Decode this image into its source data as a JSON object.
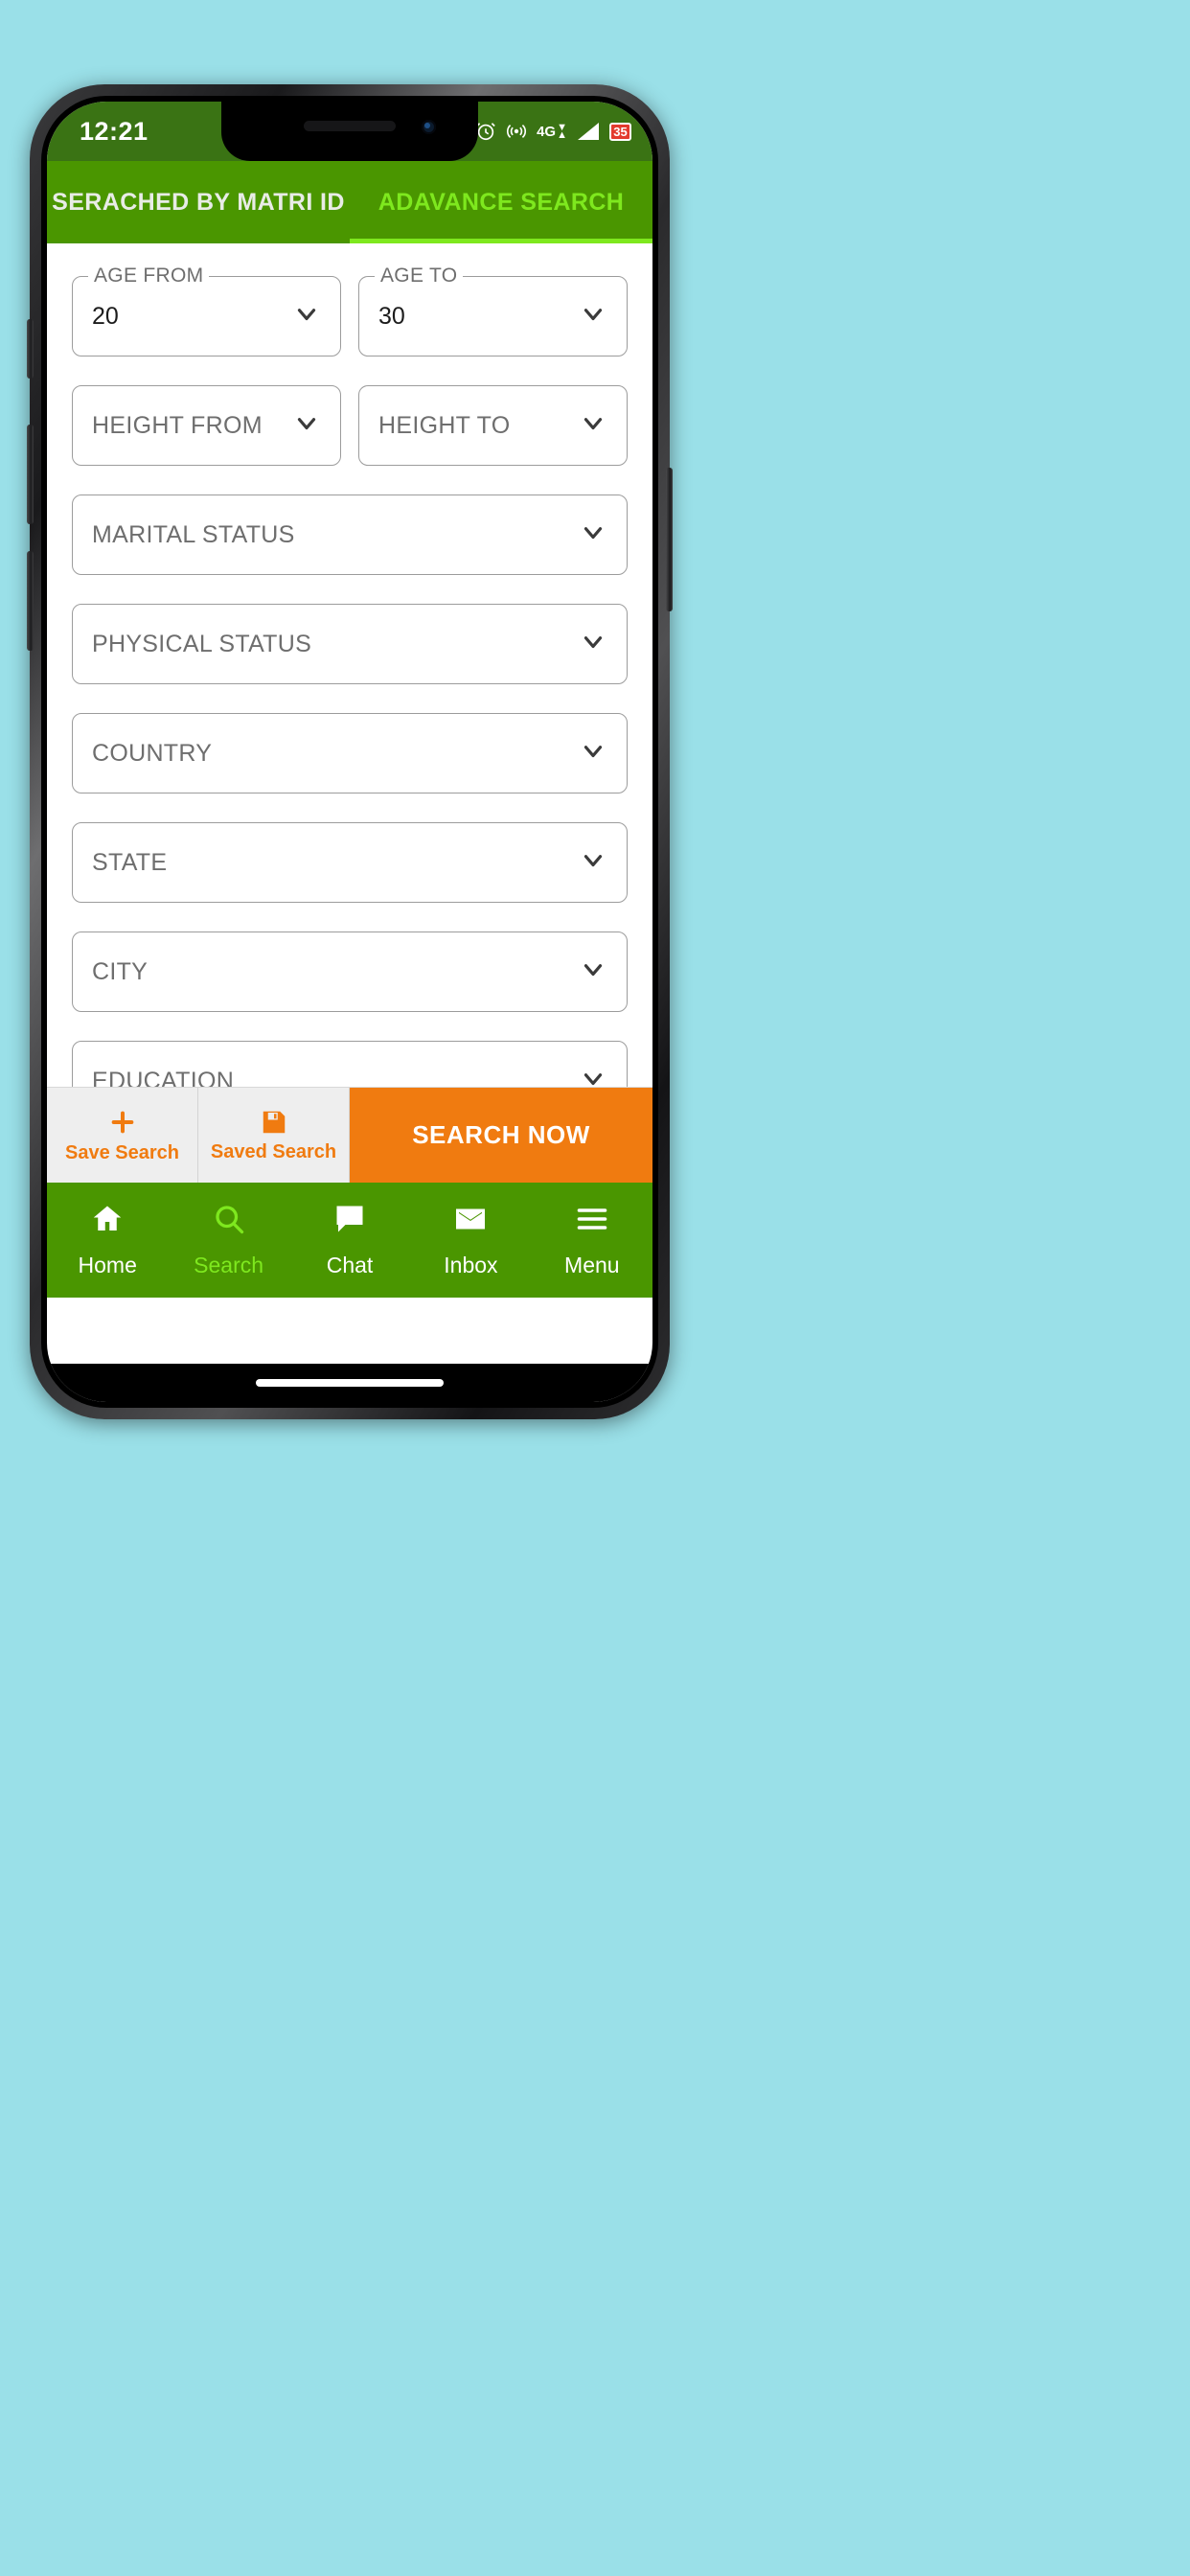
{
  "status_bar": {
    "time": "12:21",
    "icons": [
      {
        "name": "alarm-icon"
      },
      {
        "name": "wifi-hotspot-icon"
      },
      {
        "name": "network-4g-icon",
        "label": "4G"
      },
      {
        "name": "signal-bars-icon"
      }
    ],
    "battery_level": "35"
  },
  "tabs": [
    {
      "label": "SERACHED BY MATRI ID",
      "active": false,
      "name": "tab-searched-by-matri-id"
    },
    {
      "label": "ADAVANCE SEARCH",
      "active": true,
      "name": "tab-advance-search"
    }
  ],
  "form": {
    "rows": [
      {
        "fields": [
          {
            "name": "age-from-select",
            "float_label": "AGE FROM",
            "value": "20",
            "placeholder": ""
          },
          {
            "name": "age-to-select",
            "float_label": "AGE TO",
            "value": "30",
            "placeholder": ""
          }
        ]
      },
      {
        "fields": [
          {
            "name": "height-from-select",
            "float_label": "",
            "value": "",
            "placeholder": "HEIGHT FROM"
          },
          {
            "name": "height-to-select",
            "float_label": "",
            "value": "",
            "placeholder": "HEIGHT TO"
          }
        ]
      },
      {
        "fields": [
          {
            "name": "marital-status-select",
            "float_label": "",
            "value": "",
            "placeholder": "MARITAL STATUS"
          }
        ]
      },
      {
        "fields": [
          {
            "name": "physical-status-select",
            "float_label": "",
            "value": "",
            "placeholder": "PHYSICAL STATUS"
          }
        ]
      },
      {
        "fields": [
          {
            "name": "country-select",
            "float_label": "",
            "value": "",
            "placeholder": "COUNTRY"
          }
        ]
      },
      {
        "fields": [
          {
            "name": "state-select",
            "float_label": "",
            "value": "",
            "placeholder": "STATE"
          }
        ]
      },
      {
        "fields": [
          {
            "name": "city-select",
            "float_label": "",
            "value": "",
            "placeholder": "CITY"
          }
        ]
      },
      {
        "fields": [
          {
            "name": "education-select",
            "float_label": "",
            "value": "",
            "placeholder": "EDUCATION"
          }
        ]
      }
    ]
  },
  "action_bar": {
    "save_search_label": "Save Search",
    "save_search_icon": "plus-icon",
    "saved_search_label": "Saved Search",
    "saved_search_icon": "floppy-disk-icon",
    "search_now_label": "SEARCH NOW"
  },
  "bottom_nav": [
    {
      "label": "Home",
      "icon": "home-icon",
      "active": false,
      "name": "nav-item-home"
    },
    {
      "label": "Search",
      "icon": "search-icon",
      "active": true,
      "name": "nav-item-search"
    },
    {
      "label": "Chat",
      "icon": "chat-icon",
      "active": false,
      "name": "nav-item-chat"
    },
    {
      "label": "Inbox",
      "icon": "envelope-icon",
      "active": false,
      "name": "nav-item-inbox"
    },
    {
      "label": "Menu",
      "icon": "hamburger-icon",
      "active": false,
      "name": "nav-item-menu"
    }
  ],
  "colors": {
    "brand_green": "#4a9600",
    "status_green": "#3a7314",
    "accent_green": "#7ee81e",
    "orange": "#f07b10",
    "background": "#9ae0e8"
  }
}
